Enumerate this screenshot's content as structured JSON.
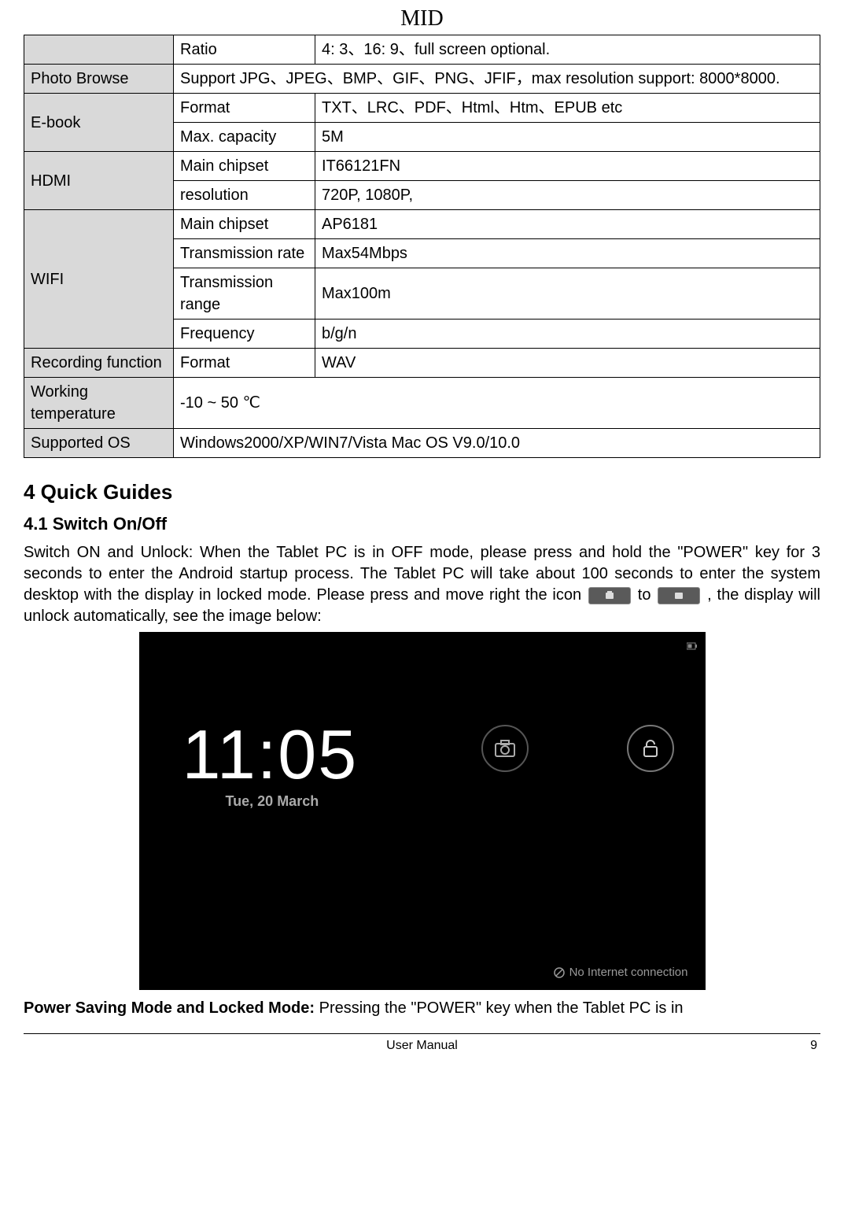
{
  "header": {
    "title": "MID"
  },
  "table": {
    "rows": [
      {
        "cat": "",
        "sub": "Ratio",
        "val": "4: 3、16: 9、full screen optional."
      },
      {
        "cat": "Photo Browse",
        "val": "Support JPG、JPEG、BMP、GIF、PNG、JFIF，max resolution support: 8000*8000."
      },
      {
        "cat": "E-book",
        "subs": [
          {
            "sub": "Format",
            "val": "TXT、LRC、PDF、Html、Htm、EPUB etc"
          },
          {
            "sub": "Max. capacity",
            "val": "5M"
          }
        ]
      },
      {
        "cat": "HDMI",
        "subs": [
          {
            "sub": "Main chipset",
            "val": "IT66121FN"
          },
          {
            "sub": "resolution",
            "val": "720P, 1080P,"
          }
        ]
      },
      {
        "cat": "WIFI",
        "subs": [
          {
            "sub": "Main chipset",
            "val": "AP6181"
          },
          {
            "sub": "Transmission rate",
            "val": "Max54Mbps"
          },
          {
            "sub": "Transmission range",
            "val": "Max100m"
          },
          {
            "sub": "Frequency",
            "val": "b/g/n"
          }
        ]
      },
      {
        "cat": "Recording function",
        "sub": "Format",
        "val": "WAV"
      },
      {
        "cat": "Working temperature",
        "val": "-10   ~ 50 ℃"
      },
      {
        "cat": "Supported OS",
        "val": "Windows2000/XP/WIN7/Vista   Mac OS V9.0/10.0"
      }
    ]
  },
  "sections": {
    "s4_title": "4 Quick Guides",
    "s4_1_title": "4.1 Switch On/Off",
    "p1_a": "Switch ON and Unlock: When the Tablet PC is in OFF mode, please press and hold the \"POWER\" key for 3 seconds to enter the Android startup process. The Tablet PC will take about 100 seconds to enter the system desktop with the display in locked mode. Please press and move right the icon",
    "p1_b": " to",
    "p1_c": ", the display will unlock automatically, see the image below:",
    "p2_bold": "Power Saving Mode and Locked Mode: ",
    "p2_rest": "Pressing the \"POWER\" key when the Tablet PC is in"
  },
  "lockscreen": {
    "time": "11:05",
    "date": "Tue, 20 March",
    "status": "No Internet connection"
  },
  "footer": {
    "center": "User Manual",
    "page": "9"
  }
}
